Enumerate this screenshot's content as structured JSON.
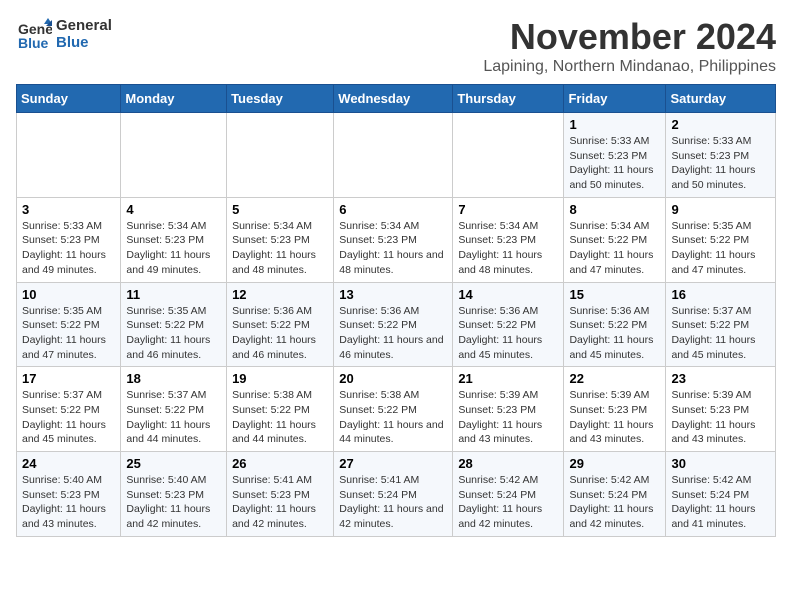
{
  "logo": {
    "line1": "General",
    "line2": "Blue"
  },
  "title": "November 2024",
  "location": "Lapining, Northern Mindanao, Philippines",
  "weekdays": [
    "Sunday",
    "Monday",
    "Tuesday",
    "Wednesday",
    "Thursday",
    "Friday",
    "Saturday"
  ],
  "weeks": [
    [
      {
        "day": "",
        "info": ""
      },
      {
        "day": "",
        "info": ""
      },
      {
        "day": "",
        "info": ""
      },
      {
        "day": "",
        "info": ""
      },
      {
        "day": "",
        "info": ""
      },
      {
        "day": "1",
        "info": "Sunrise: 5:33 AM\nSunset: 5:23 PM\nDaylight: 11 hours and 50 minutes."
      },
      {
        "day": "2",
        "info": "Sunrise: 5:33 AM\nSunset: 5:23 PM\nDaylight: 11 hours and 50 minutes."
      }
    ],
    [
      {
        "day": "3",
        "info": "Sunrise: 5:33 AM\nSunset: 5:23 PM\nDaylight: 11 hours and 49 minutes."
      },
      {
        "day": "4",
        "info": "Sunrise: 5:34 AM\nSunset: 5:23 PM\nDaylight: 11 hours and 49 minutes."
      },
      {
        "day": "5",
        "info": "Sunrise: 5:34 AM\nSunset: 5:23 PM\nDaylight: 11 hours and 48 minutes."
      },
      {
        "day": "6",
        "info": "Sunrise: 5:34 AM\nSunset: 5:23 PM\nDaylight: 11 hours and 48 minutes."
      },
      {
        "day": "7",
        "info": "Sunrise: 5:34 AM\nSunset: 5:23 PM\nDaylight: 11 hours and 48 minutes."
      },
      {
        "day": "8",
        "info": "Sunrise: 5:34 AM\nSunset: 5:22 PM\nDaylight: 11 hours and 47 minutes."
      },
      {
        "day": "9",
        "info": "Sunrise: 5:35 AM\nSunset: 5:22 PM\nDaylight: 11 hours and 47 minutes."
      }
    ],
    [
      {
        "day": "10",
        "info": "Sunrise: 5:35 AM\nSunset: 5:22 PM\nDaylight: 11 hours and 47 minutes."
      },
      {
        "day": "11",
        "info": "Sunrise: 5:35 AM\nSunset: 5:22 PM\nDaylight: 11 hours and 46 minutes."
      },
      {
        "day": "12",
        "info": "Sunrise: 5:36 AM\nSunset: 5:22 PM\nDaylight: 11 hours and 46 minutes."
      },
      {
        "day": "13",
        "info": "Sunrise: 5:36 AM\nSunset: 5:22 PM\nDaylight: 11 hours and 46 minutes."
      },
      {
        "day": "14",
        "info": "Sunrise: 5:36 AM\nSunset: 5:22 PM\nDaylight: 11 hours and 45 minutes."
      },
      {
        "day": "15",
        "info": "Sunrise: 5:36 AM\nSunset: 5:22 PM\nDaylight: 11 hours and 45 minutes."
      },
      {
        "day": "16",
        "info": "Sunrise: 5:37 AM\nSunset: 5:22 PM\nDaylight: 11 hours and 45 minutes."
      }
    ],
    [
      {
        "day": "17",
        "info": "Sunrise: 5:37 AM\nSunset: 5:22 PM\nDaylight: 11 hours and 45 minutes."
      },
      {
        "day": "18",
        "info": "Sunrise: 5:37 AM\nSunset: 5:22 PM\nDaylight: 11 hours and 44 minutes."
      },
      {
        "day": "19",
        "info": "Sunrise: 5:38 AM\nSunset: 5:22 PM\nDaylight: 11 hours and 44 minutes."
      },
      {
        "day": "20",
        "info": "Sunrise: 5:38 AM\nSunset: 5:22 PM\nDaylight: 11 hours and 44 minutes."
      },
      {
        "day": "21",
        "info": "Sunrise: 5:39 AM\nSunset: 5:23 PM\nDaylight: 11 hours and 43 minutes."
      },
      {
        "day": "22",
        "info": "Sunrise: 5:39 AM\nSunset: 5:23 PM\nDaylight: 11 hours and 43 minutes."
      },
      {
        "day": "23",
        "info": "Sunrise: 5:39 AM\nSunset: 5:23 PM\nDaylight: 11 hours and 43 minutes."
      }
    ],
    [
      {
        "day": "24",
        "info": "Sunrise: 5:40 AM\nSunset: 5:23 PM\nDaylight: 11 hours and 43 minutes."
      },
      {
        "day": "25",
        "info": "Sunrise: 5:40 AM\nSunset: 5:23 PM\nDaylight: 11 hours and 42 minutes."
      },
      {
        "day": "26",
        "info": "Sunrise: 5:41 AM\nSunset: 5:23 PM\nDaylight: 11 hours and 42 minutes."
      },
      {
        "day": "27",
        "info": "Sunrise: 5:41 AM\nSunset: 5:24 PM\nDaylight: 11 hours and 42 minutes."
      },
      {
        "day": "28",
        "info": "Sunrise: 5:42 AM\nSunset: 5:24 PM\nDaylight: 11 hours and 42 minutes."
      },
      {
        "day": "29",
        "info": "Sunrise: 5:42 AM\nSunset: 5:24 PM\nDaylight: 11 hours and 42 minutes."
      },
      {
        "day": "30",
        "info": "Sunrise: 5:42 AM\nSunset: 5:24 PM\nDaylight: 11 hours and 41 minutes."
      }
    ]
  ]
}
